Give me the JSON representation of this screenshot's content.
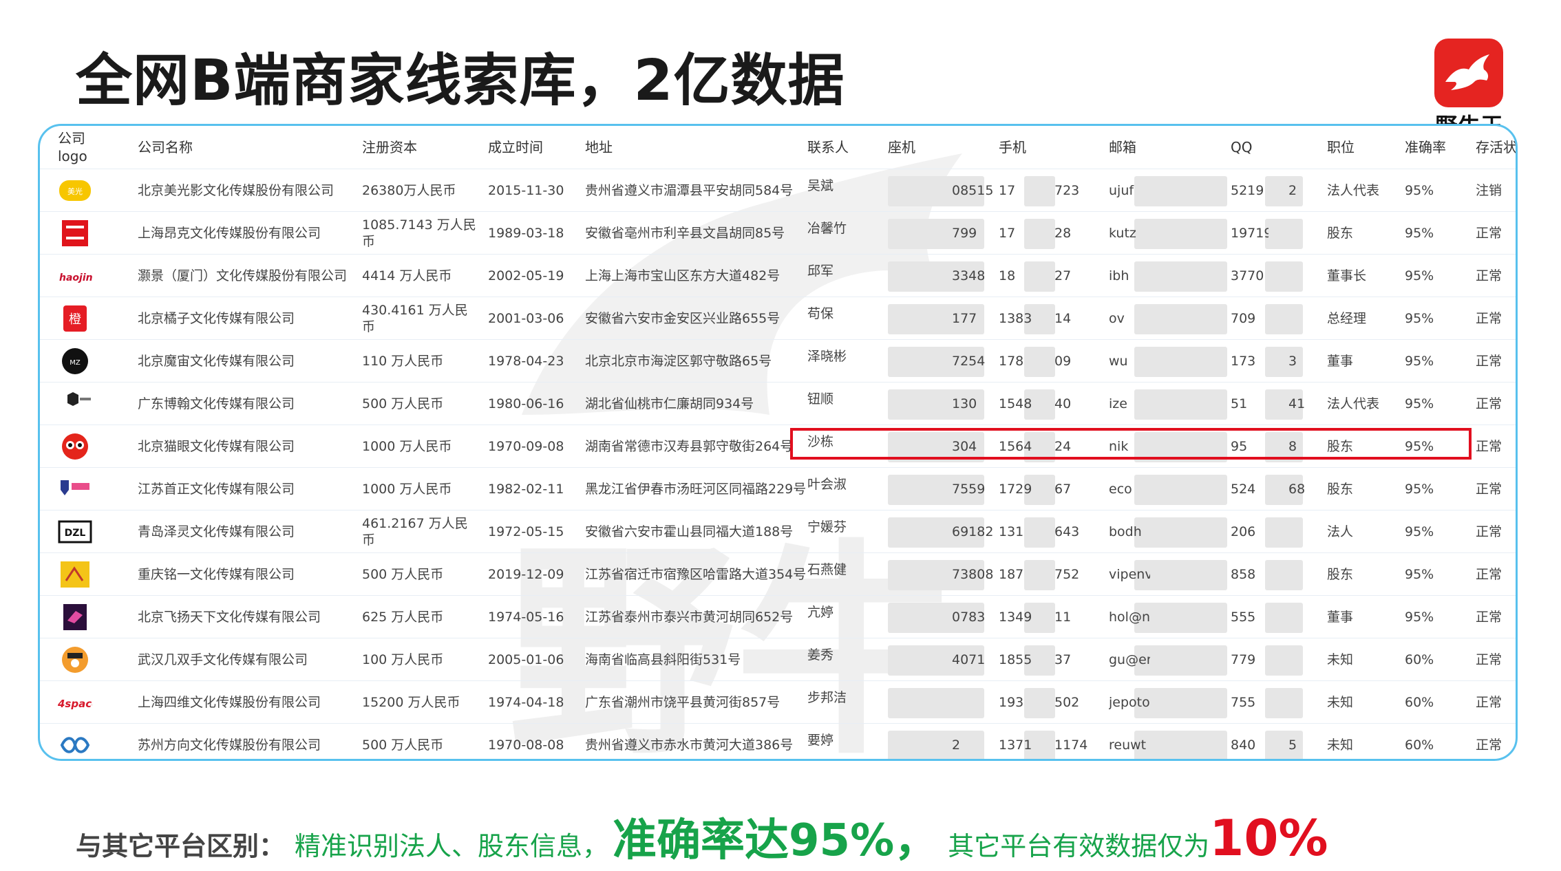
{
  "title": "全网B端商家线索库，2亿数据",
  "brand": {
    "name": "野牛王",
    "logo_icon": "bull-icon",
    "color": "#e52421"
  },
  "table": {
    "headers": [
      "公司logo",
      "公司名称",
      "注册资本",
      "成立时间",
      "地址",
      "联系人",
      "座机",
      "手机",
      "邮箱",
      "QQ",
      "职位",
      "准确率",
      "存活状"
    ],
    "rows": [
      {
        "logo": "logo-meiguang",
        "name": "北京美光影文化传媒股份有限公司",
        "capital": "26380万人民币",
        "founded": "2015-11-30",
        "address": "贵州省遵义市湄潭县平安胡同584号",
        "contact": "吴斌",
        "landline": "08515",
        "mobile_head": "17",
        "mobile_tail": "723",
        "email": "ujuf",
        "qq_head": "5219",
        "qq_tail": "2",
        "role": "法人代表",
        "accuracy": "95%",
        "status": "注销"
      },
      {
        "logo": "logo-angke",
        "name": "上海昂克文化传媒股份有限公司",
        "capital": "1085.7143 万人民币",
        "founded": "1989-03-18",
        "address": "安徽省亳州市利辛县文昌胡同85号",
        "contact": "冶馨竹",
        "landline": "799",
        "mobile_head": "17",
        "mobile_tail": "28",
        "email": "kutz",
        "qq_head": "19719",
        "qq_tail": "",
        "role": "股东",
        "accuracy": "95%",
        "status": "正常"
      },
      {
        "logo": "logo-haojing",
        "name": "灏景（厦门）文化传媒股份有限公司",
        "capital": "4414 万人民币",
        "founded": "2002-05-19",
        "address": "上海上海市宝山区东方大道482号",
        "contact": "邱军",
        "landline": "3348",
        "mobile_head": "18",
        "mobile_tail": "27",
        "email": "ibh",
        "qq_head": "3770",
        "qq_tail": "",
        "role": "董事长",
        "accuracy": "95%",
        "status": "正常"
      },
      {
        "logo": "logo-juzi",
        "name": "北京橘子文化传媒有限公司",
        "capital": "430.4161 万人民币",
        "founded": "2001-03-06",
        "address": "安徽省六安市金安区兴业路655号",
        "contact": "苟保",
        "landline": "177",
        "mobile_head": "1383",
        "mobile_tail": "14",
        "email": "ov",
        "qq_head": "709",
        "qq_tail": "",
        "role": "总经理",
        "accuracy": "95%",
        "status": "正常"
      },
      {
        "logo": "logo-mozhou",
        "name": "北京魔宙文化传媒有限公司",
        "capital": "110 万人民币",
        "founded": "1978-04-23",
        "address": "北京北京市海淀区郭守敬路65号",
        "contact": "泽晓彬",
        "landline": "7254",
        "mobile_head": "178",
        "mobile_tail": "09",
        "email": "wu",
        "qq_head": "173",
        "qq_tail": "3",
        "role": "董事",
        "accuracy": "95%",
        "status": "正常"
      },
      {
        "logo": "logo-bohan",
        "name": "广东博翰文化传媒有限公司",
        "capital": "500 万人民币",
        "founded": "1980-06-16",
        "address": "湖北省仙桃市仁廉胡同934号",
        "contact": "钮顺",
        "landline": "130",
        "mobile_head": "1548",
        "mobile_tail": "40",
        "email": "ize",
        "qq_head": "51",
        "qq_tail": "41",
        "role": "法人代表",
        "accuracy": "95%",
        "status": "正常"
      },
      {
        "logo": "logo-maoyan",
        "name": "北京猫眼文化传媒有限公司",
        "capital": "1000 万人民币",
        "founded": "1970-09-08",
        "address": "湖南省常德市汉寿县郭守敬街264号",
        "contact": "沙栋",
        "landline": "304",
        "mobile_head": "1564",
        "mobile_tail": "24",
        "email": "nik",
        "qq_head": "95",
        "qq_tail": "8",
        "role": "股东",
        "accuracy": "95%",
        "status": "正常"
      },
      {
        "logo": "logo-shouzheng",
        "name": "江苏首正文化传媒有限公司",
        "capital": "1000 万人民币",
        "founded": "1982-02-11",
        "address": "黑龙江省伊春市汤旺河区同福路229号",
        "contact": "叶会淑",
        "landline": "7559",
        "mobile_head": "1729",
        "mobile_tail": "67",
        "email": "eco",
        "qq_head": "524",
        "qq_tail": "68",
        "role": "股东",
        "accuracy": "95%",
        "status": "正常"
      },
      {
        "logo": "logo-dzl",
        "name": "青岛泽灵文化传媒有限公司",
        "capital": "461.2167 万人民币",
        "founded": "1972-05-15",
        "address": "安徽省六安市霍山县同福大道188号",
        "contact": "宁媛芬",
        "landline": "69182",
        "mobile_head": "131",
        "mobile_tail": "643",
        "email": "bodh",
        "qq_head": "206",
        "qq_tail": "",
        "role": "法人",
        "accuracy": "95%",
        "status": "正常"
      },
      {
        "logo": "logo-mingyi",
        "name": "重庆铭一文化传媒有限公司",
        "capital": "500 万人民币",
        "founded": "2019-12-09",
        "address": "江苏省宿迁市宿豫区哈雷路大道354号",
        "contact": "石燕健",
        "landline": "73808",
        "mobile_head": "187",
        "mobile_tail": "752",
        "email": "vipenv",
        "qq_head": "858",
        "qq_tail": "",
        "role": "股东",
        "accuracy": "95%",
        "status": "正常"
      },
      {
        "logo": "logo-feiyang",
        "name": "北京飞扬天下文化传媒有限公司",
        "capital": "625 万人民币",
        "founded": "1974-05-16",
        "address": "江苏省泰州市泰兴市黄河胡同652号",
        "contact": "亢婷",
        "landline": "0783",
        "mobile_head": "1349",
        "mobile_tail": "11",
        "email": "hol@n",
        "qq_head": "555",
        "qq_tail": "",
        "role": "董事",
        "accuracy": "95%",
        "status": "正常"
      },
      {
        "logo": "logo-jishuang",
        "name": "武汉几双手文化传媒有限公司",
        "capital": "100 万人民币",
        "founded": "2005-01-06",
        "address": "海南省临高县斜阳街531号",
        "contact": "姜秀",
        "landline": "4071",
        "mobile_head": "18551",
        "mobile_tail": "37",
        "email": "gu@er",
        "qq_head": "779",
        "qq_tail": "",
        "role": "未知",
        "accuracy": "60%",
        "status": "正常"
      },
      {
        "logo": "logo-4space",
        "name": "上海四维文化传媒股份有限公司",
        "capital": "15200 万人民币",
        "founded": "1974-04-18",
        "address": "广东省潮州市饶平县黄河街857号",
        "contact": "步邦洁",
        "landline": "",
        "mobile_head": "193",
        "mobile_tail": "502",
        "email": "jepoto",
        "qq_head": "755",
        "qq_tail": "",
        "role": "未知",
        "accuracy": "60%",
        "status": "正常"
      },
      {
        "logo": "logo-fangxiang",
        "name": "苏州方向文化传媒股份有限公司",
        "capital": "500 万人民币",
        "founded": "1970-08-08",
        "address": "贵州省遵义市赤水市黄河大道386号",
        "contact": "要婷",
        "landline": "2",
        "mobile_head": "1371",
        "mobile_tail": "1174",
        "email": "reuwt",
        "qq_head": "840",
        "qq_tail": "5",
        "role": "未知",
        "accuracy": "60%",
        "status": "正常"
      }
    ]
  },
  "footer": {
    "lead": "与其它平台区别：",
    "part1": "精准识别法人、股东信息，",
    "highlight": "准确率达95%，",
    "part2": "其它平台有效数据仅为",
    "percent": "10%"
  },
  "colors": {
    "border": "#58c1ee",
    "highlight": "#e10f1f",
    "green": "#17a34a",
    "red": "#e10f1f"
  }
}
